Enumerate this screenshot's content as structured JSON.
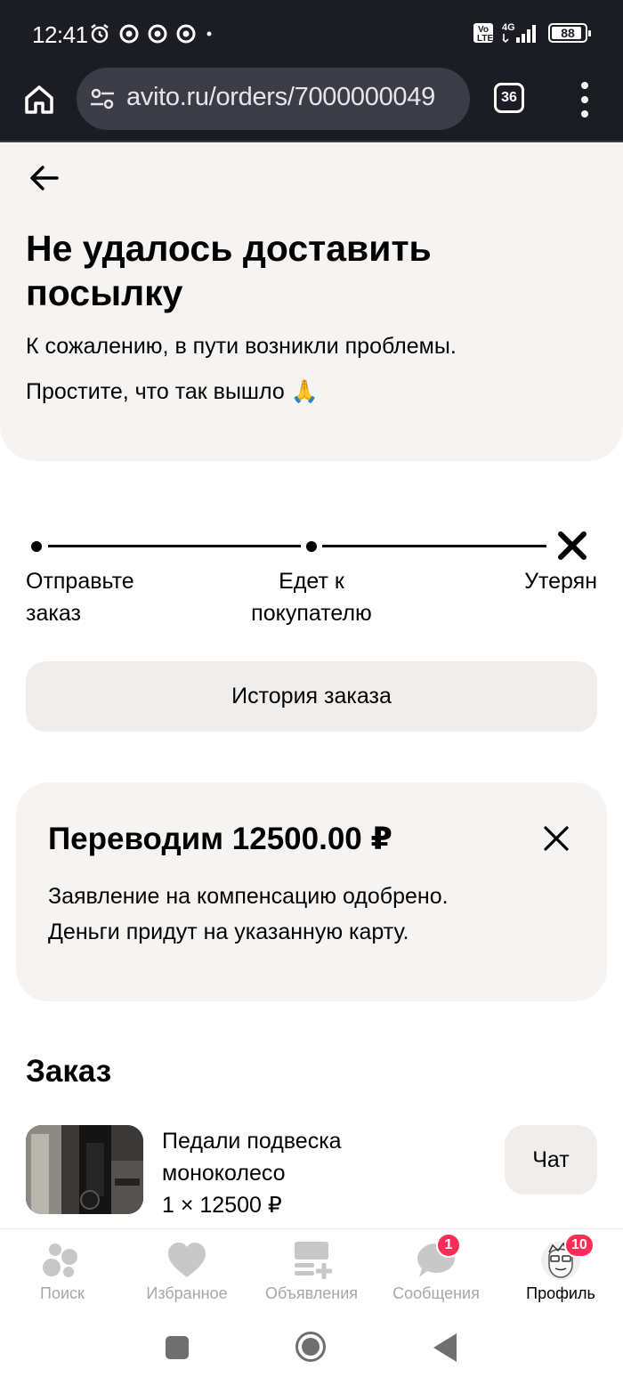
{
  "status_bar": {
    "time": "12:41",
    "network": "4G",
    "volte": "Vo LTE",
    "battery": "88"
  },
  "browser": {
    "url": "avito.ru/orders/7000000049",
    "tabs_count": "36"
  },
  "header": {
    "title": "Не удалось доставить посылку",
    "subtitle_1": "К сожалению, в пути возникли проблемы.",
    "subtitle_2": "Простите, что так вышло 🙏"
  },
  "stepper": {
    "steps": [
      {
        "label_line1": "Отправьте",
        "label_line2": "заказ"
      },
      {
        "label_line1": "Едет к",
        "label_line2": "покупателю"
      },
      {
        "label_line1": "Утерян",
        "label_line2": ""
      }
    ]
  },
  "history_button": "История заказа",
  "compensation": {
    "title": "Переводим 12500.00 ₽",
    "line_1": "Заявление на компенсацию одобрено.",
    "line_2": "Деньги придут на указанную карту."
  },
  "order": {
    "heading": "Заказ",
    "product_name": "Педали подвеска моноколесо",
    "product_qty": "1 × 12500 ₽",
    "chat_button": "Чат"
  },
  "tabbar": {
    "tabs": [
      {
        "label": "Поиск",
        "icon": "search-dots-icon"
      },
      {
        "label": "Избранное",
        "icon": "heart-icon"
      },
      {
        "label": "Объявления",
        "icon": "listing-add-icon"
      },
      {
        "label": "Сообщения",
        "icon": "chat-bubble-icon",
        "badge": "1"
      },
      {
        "label": "Профиль",
        "icon": "avatar-icon",
        "badge": "10"
      }
    ]
  },
  "colors": {
    "accent_badge": "#ff2d55",
    "card_bg": "#f5f4f2",
    "status_bar_bg": "#1b1c24"
  }
}
